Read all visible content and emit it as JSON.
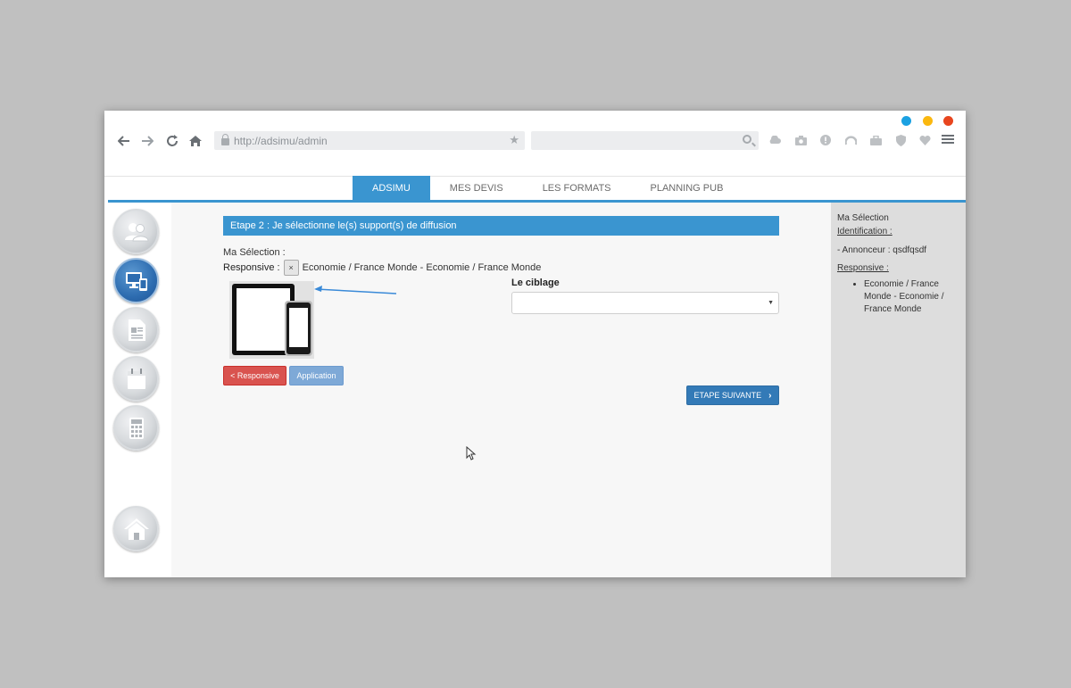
{
  "browser": {
    "url": "http://adsimu/admin",
    "search_placeholder": "",
    "toolbar_icons": [
      "cloud-icon",
      "camera-icon",
      "alert-icon",
      "gauge-icon",
      "briefcase-icon",
      "shield-icon",
      "heart-icon"
    ],
    "window_dots": [
      "#1ba1e2",
      "#fbb80f",
      "#e8451e"
    ]
  },
  "tabs": [
    {
      "label": "ADSIMU",
      "active": true
    },
    {
      "label": "MES DEVIS",
      "active": false
    },
    {
      "label": "LES FORMATS",
      "active": false
    },
    {
      "label": "PLANNING PUB",
      "active": false
    }
  ],
  "sidebar": {
    "items": [
      {
        "icon": "users-icon",
        "active": false
      },
      {
        "icon": "devices-icon",
        "active": true
      },
      {
        "icon": "document-icon",
        "active": false
      },
      {
        "icon": "calendar-icon",
        "active": false
      },
      {
        "icon": "calculator-icon",
        "active": false
      },
      {
        "icon": "home-icon",
        "active": false
      }
    ]
  },
  "main": {
    "step_title": "Etape 2 : Je sélectionne le(s) support(s) de diffusion",
    "selection_label": "Ma Sélection :",
    "responsive_label": "Responsive :",
    "remove_label": "×",
    "selection_value": "Economie / France Monde - Economie / France Monde",
    "btn_responsive": "< Responsive",
    "btn_application": "Application",
    "ciblage_label": "Le ciblage",
    "ciblage_value": "",
    "btn_next": "ETAPE SUIVANTE",
    "next_chevron": "›"
  },
  "summary": {
    "title": "Ma Sélection",
    "identification": "Identification :",
    "annonceur": "-  Annonceur : qsdfqsdf",
    "responsive": "Responsive :",
    "responsive_items": [
      "Economie / France Monde - Economie / France Monde"
    ]
  },
  "colors": {
    "accent": "#3a95d0",
    "danger": "#d9534f",
    "primary": "#337ab7"
  }
}
